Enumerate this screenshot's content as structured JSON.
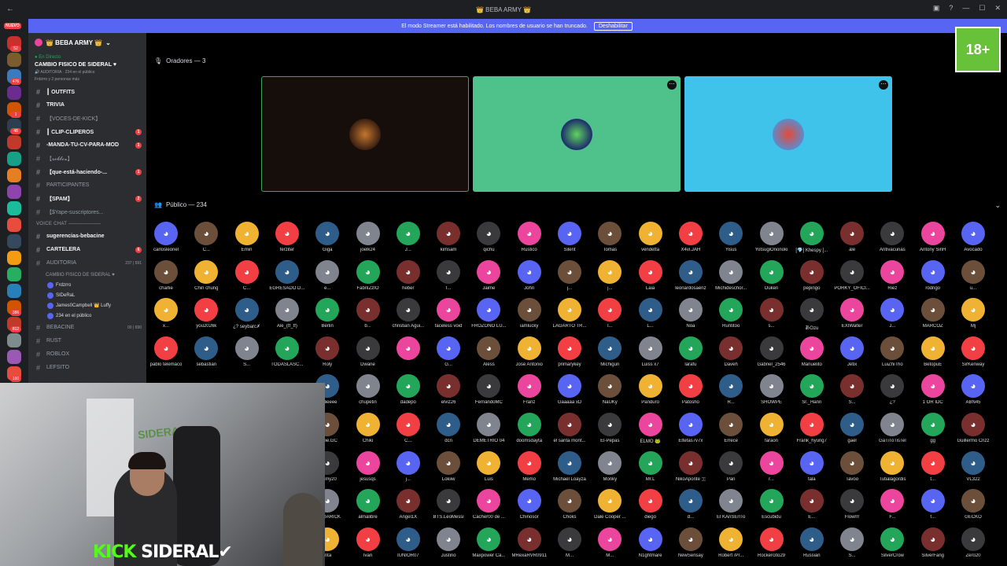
{
  "titlebar": {
    "title": "👑 BEBA ARMY 👑",
    "back": "←",
    "min": "—",
    "max": "☐",
    "close": "✕"
  },
  "banner": {
    "text": "El modo Streamer está habilitado. Los nombres de usuario se han truncado.",
    "button": "Deshabilitar"
  },
  "rail": {
    "nuevo": "NUEVO",
    "badges": [
      "52",
      "",
      "476",
      "",
      "1",
      "48",
      "",
      "",
      "",
      "",
      "",
      "",
      "",
      "",
      "",
      "",
      "386",
      "812",
      "",
      "",
      "160",
      "190",
      "157"
    ]
  },
  "server": {
    "name": "👑 BEBA ARMY 👑"
  },
  "live": {
    "label": "● En Directo",
    "title": "CAMBIO FISICO DE SIDERAL ♥",
    "sub": "🔊 AUDITORIA · 234 en el público",
    "people": "Frdzrro y 2 personas más"
  },
  "channels": [
    {
      "name": "┃ OUTFITS",
      "bold": true,
      "ping": ""
    },
    {
      "name": "TRIVIA",
      "bold": true,
      "ping": ""
    },
    {
      "name": "【VOCES-DE-KICK】",
      "bold": false,
      "ping": ""
    },
    {
      "name": "┃ CLIP-CLIPEROS",
      "bold": true,
      "ping": "1"
    },
    {
      "name": "-MANDA-TU-CV-PARA-MOD",
      "bold": true,
      "ping": "1"
    },
    {
      "name": "【𝓻𝓸𝓫𝓵𝓸𝔁】",
      "bold": false,
      "ping": ""
    },
    {
      "name": "【que-está-haciendo-...",
      "bold": true,
      "ping": "1"
    },
    {
      "name": "PARTICIPANTES",
      "bold": false,
      "ping": ""
    },
    {
      "name": "【SPAM】",
      "bold": true,
      "ping": "2"
    },
    {
      "name": "【$Yape-suscriptores...",
      "bold": false,
      "ping": ""
    }
  ],
  "voice_category": "VOICE CHAT ─────────",
  "voice_channels": [
    {
      "name": "sugerencias-bebacine",
      "bold": true
    },
    {
      "name": "CARTELERA",
      "bold": true,
      "ping": "6"
    },
    {
      "name": "AUDITORIA",
      "count": "237 | 591"
    }
  ],
  "auditoria_sub": "CAMBIO FISICO DE SIDERAL ♥",
  "voice_users": [
    "Frdzrro",
    "SIDeRaL",
    "James0Campbell 👑 Luffy",
    "234 en el público"
  ],
  "bottom_channels": [
    {
      "name": "BEBACINE",
      "count": "00 | 690"
    },
    {
      "name": "RUST"
    },
    {
      "name": "ROBLOX"
    },
    {
      "name": "LEFSITO"
    }
  ],
  "stage": {
    "speakers_label": "Oradores — 3",
    "audience_label": "Público — 234"
  },
  "age_badge": "18+",
  "audience": [
    "carlosleonel",
    "C...",
    "Emin",
    "ferziter",
    "Giga",
    "joelk24",
    "J...",
    "kimsam",
    "qichu",
    "Rustico",
    "Silent",
    "Tomas",
    "vendetta",
    "X4vi.JAH",
    "Yisus",
    "YotsugiOnonoki",
    "[💎] Khespy [...",
    "ale",
    "Antivacunas",
    "Antony SinH",
    "Avocado",
    "charlie",
    "Chin chung",
    "C...",
    "EGRESADO D...",
    "e...",
    "FabrilZzIO",
    "heber",
    "I...",
    "Jaime",
    "John",
    "j...",
    "j...",
    "Laia",
    "leonardosaenz",
    "Michideschor...",
    "Ouken",
    "pepingo",
    "PORKY_OFICI...",
    "Riez",
    "rodrigo",
    "u...",
    "x...",
    "you2026k",
    "¿? seybarc✗",
    "Ale_(tf_tf)",
    "Berlin",
    "b...",
    "christian Agui...",
    "faceless void",
    "FROZONO LU...",
    "iamlucky",
    "LAGARTO TR...",
    "I...",
    "L...",
    "Noa",
    "Runtitoo",
    "s...",
    "あOzu",
    "EXIWalter",
    "J...",
    "MARCOZ",
    "Mj",
    "pablo telemaco",
    "sebastián",
    "S...",
    "TODASLASC...",
    "Roly",
    "Dwane",
    "",
    "G...",
    "Aless",
    "Jose Antonio",
    "primarykey",
    "Michigun",
    "Luiss x7",
    "larafu",
    "Daveh",
    "Gabriel_2546",
    "Manuelito",
    "Jetix",
    "LuiZhiTho",
    "BetopuE",
    "SirKenway",
    "addieeee",
    "chupetin",
    "dadepo",
    "elviz26",
    "FernandoMC",
    "Franz",
    "Gaaaaa xD",
    "NaUKy",
    "Panduro",
    "Patosho",
    "R...",
    "SHOWPE",
    "Sr._Hann",
    "S...",
    "¿?",
    "1 OR IDC",
    "ABN45",
    "harlie.GC",
    "Chiki",
    "C...",
    "dcn",
    "DEMETRIO 04",
    "doomsdayta",
    "el santa mont...",
    "El-Pepas",
    "ELMO 🐸",
    "Eltetas7v7x",
    "Errece",
    "faraon",
    "Frank_hyung7",
    "gael",
    "GaTiToTisTel",
    "gg",
    "Guillermo Crizz",
    "eremy20",
    "jesusqs",
    "j...",
    "Lokiiw",
    "Luis",
    "Memo",
    "Michael Loayza",
    "Monky",
    "Mr.L",
    "NikoAponte 🇮",
    "Pan",
    "r...",
    "tala",
    "Tavoo",
    "Tutialagordis",
    "t...",
    "VL322",
    "TAYDARICK",
    "almalibre",
    "Angel1X",
    "BTS.LeoMessi",
    "Cacher00 de ...",
    "Chinosor",
    "Choks",
    "Dale Cooper ...",
    "diego",
    "d...",
    "El KAnSErITo",
    "Escubidu",
    "E...",
    "Flowrrr",
    "F...",
    "f...",
    "GECKO",
    "Inta",
    "Ivan",
    "IUNIOR07",
    "Justino",
    "Maxpower Ca...",
    "MRexaRVR0911",
    "M...",
    "M...",
    "N1ghtmare",
    "NewSensay",
    "Robert /Pr...",
    "Rockercito29",
    "Russian",
    "S...",
    "SilverCrow",
    "SilverFang",
    "Zero20"
  ],
  "colors": {
    "discord_blurple": "#5865f2",
    "red": "#f23f43",
    "green": "#23a55a",
    "pink": "#eb459e",
    "orange": "#f0b232",
    "grey": "#80848e"
  },
  "webcam": {
    "wall_logo": "SIDERAL",
    "brand_k": "KICK",
    "brand_s": "SIDERAL✔"
  }
}
